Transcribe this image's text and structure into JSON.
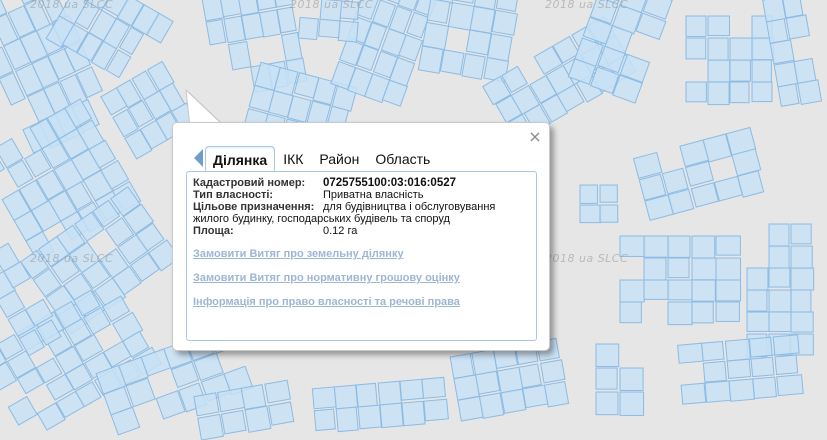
{
  "watermark": "2018 ua SLCC",
  "colors": {
    "map_background": "#e6e6e6",
    "parcel_fill": "#c8e0f4",
    "parcel_stroke": "#8dbbe3",
    "link": "#9db6d2"
  },
  "popup": {
    "close_icon": "×",
    "tabs": [
      "Ділянка",
      "ІКК",
      "Район",
      "Область"
    ],
    "active_tab": "Ділянка",
    "fields": [
      {
        "label": "Кадастровий номер:",
        "value": "0725755100:03:016:0527"
      },
      {
        "label": "Тип власності:",
        "value": "Приватна власність"
      },
      {
        "label": "Цільове призначення:",
        "value": "для будівництва і обслуговування жилого будинку, господарських будівель та споруд"
      },
      {
        "label": "Площа:",
        "value": "0.12 га"
      }
    ],
    "links": [
      "Замовити Витяг про земельну ділянку",
      "Замовити Витяг про нормативну грошову оцінку",
      "Інформація про право власності та речові права"
    ]
  }
}
